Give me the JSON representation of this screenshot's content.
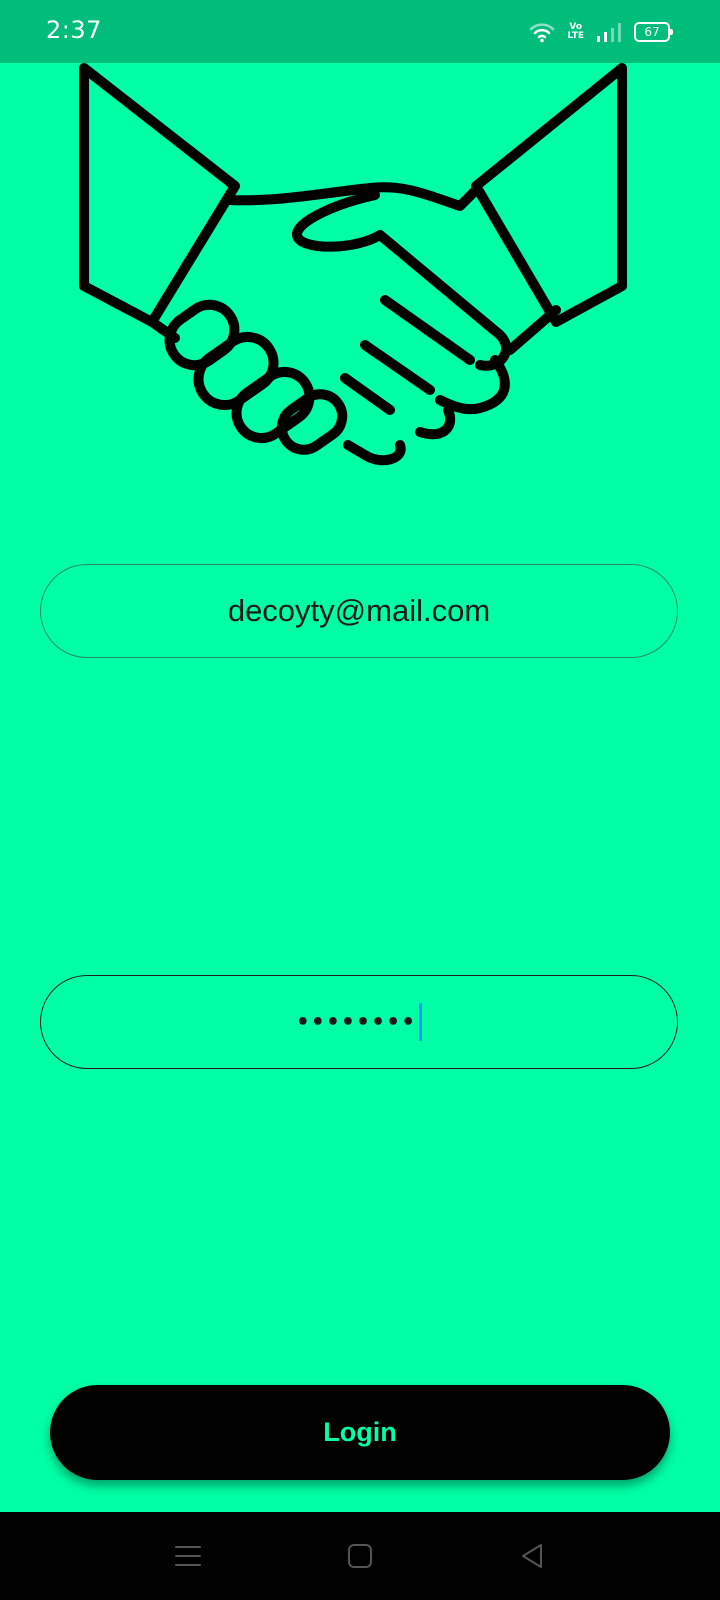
{
  "status_bar": {
    "time": "2:37",
    "network_label": "Vo\nLTE",
    "battery_level": "67",
    "icons": [
      "wifi-icon",
      "volte-icon",
      "signal-icon",
      "battery-icon"
    ]
  },
  "hero": {
    "icon": "handshake-icon"
  },
  "login_form": {
    "email_value": "decoyty@mail.com",
    "password_masked": "••••••••",
    "submit_label": "Login"
  },
  "nav_bar": {
    "icons": [
      "menu-icon",
      "home-icon",
      "back-icon"
    ]
  },
  "colors": {
    "background": "#00FFA6",
    "status_bar": "#00BD7C",
    "button_bg": "#000000",
    "button_text": "#00FFA6",
    "caret": "#2196F3"
  }
}
